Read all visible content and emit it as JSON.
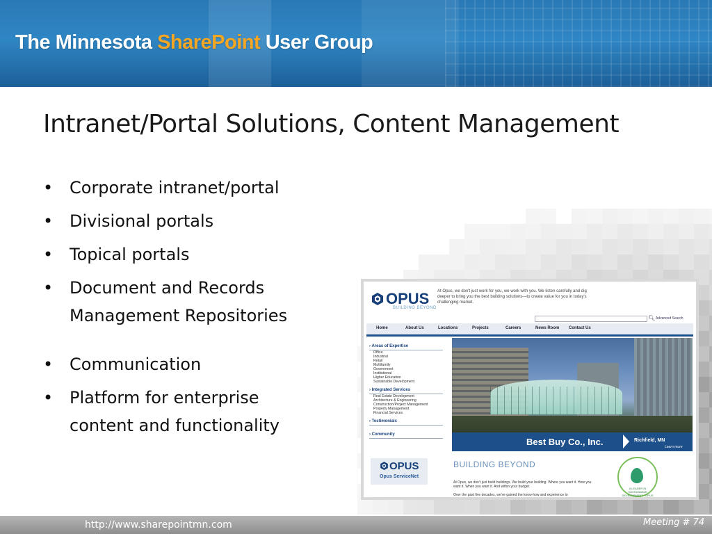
{
  "banner": {
    "title_prefix": "The Minnesota ",
    "title_accent": "SharePoint",
    "title_suffix": " User Group",
    "accent_color": "#f5a623",
    "background_color": "#2a79b6"
  },
  "slide": {
    "title": "Intranet/Portal Solutions, Content Management",
    "bullet_glyph": "•",
    "bullets": [
      "Corporate intranet/portal",
      "Divisional portals",
      "Topical portals",
      "Document and Records Management Repositories",
      "Communication",
      "Platform for enterprise content and functionality"
    ]
  },
  "screenshot": {
    "logo": "OPUS",
    "logo_tagline": "BUILDING BEYOND",
    "intro_text": "At Opus, we don't just work for you, we work with you. We listen carefully and dig deeper to bring you the best building solutions—to create value for you in today's challenging market.",
    "search_link": "Advanced Search",
    "nav": [
      "Home",
      "About Us",
      "Locations",
      "Projects",
      "Careers",
      "News Room",
      "Contact Us"
    ],
    "sidebar": {
      "areas_heading": "Areas of Expertise",
      "areas": [
        "Office",
        "Industrial",
        "Retail",
        "Multifamily",
        "Government",
        "Institutional",
        "Higher Education",
        "Sustainable Development"
      ],
      "services_heading": "Integrated Services",
      "services": [
        "Real Estate Development",
        "Architecture & Engineering",
        "Construction/Project Management",
        "Property Management",
        "Financial Services"
      ],
      "testimonials_heading": "Testimonials",
      "community_heading": "Community"
    },
    "feature_caption": "Best Buy Co., Inc.",
    "feature_location": "Richfield, MN",
    "feature_link": "Learn more",
    "service_logo": "OPUS",
    "service_name": "Opus ServiceNet",
    "heading": "BUILDING BEYOND",
    "body_text": "At Opus, we don't just build buildings. We build your building. Where you want it. How you want it. When you want it. And within your budget.",
    "body_text_2": "Over the past five decades, we've gained the know-how and experience to",
    "seal_text": "A LEADER IN SUSTAINABLE DEVELOPMENT · OPUS",
    "brand_color": "#17407a"
  },
  "footer": {
    "url": "http://www.sharepointmn.com",
    "meeting_label": "Meeting # ",
    "meeting_number": "74"
  }
}
